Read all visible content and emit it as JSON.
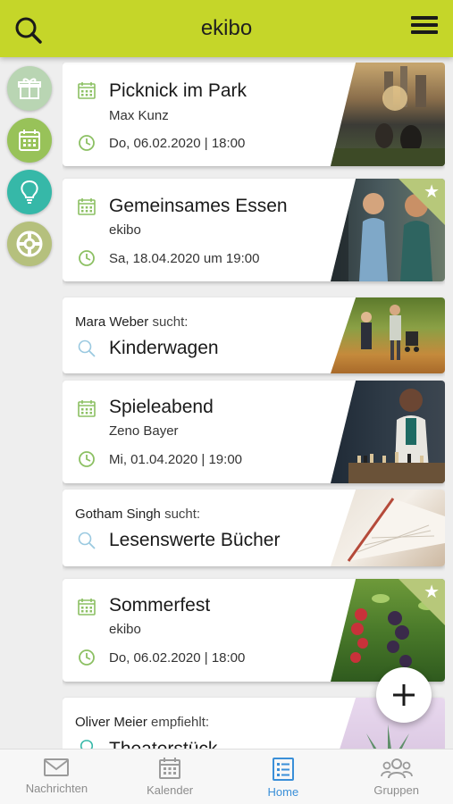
{
  "header": {
    "title": "ekibo"
  },
  "filters": [
    {
      "icon": "gift-icon",
      "color": "#b9d5b3"
    },
    {
      "icon": "calendar-icon",
      "color": "#98c259"
    },
    {
      "icon": "lightbulb-icon",
      "color": "#36b8a8"
    },
    {
      "icon": "lifebuoy-icon",
      "color": "#b5c07d"
    }
  ],
  "feed": {
    "cards": [
      {
        "type": "event",
        "title": "Picknick im Park",
        "organizer": "Max Kunz",
        "date": "Do, 06.02.2020 | 18:00",
        "starred": false
      },
      {
        "type": "event",
        "title": "Gemeinsames Essen",
        "organizer": "ekibo",
        "date": "Sa, 18.04.2020 um 19:00",
        "starred": true
      },
      {
        "type": "search",
        "user": "Mara Weber",
        "verb": "sucht:",
        "title": "Kinderwagen"
      },
      {
        "type": "event",
        "title": "Spieleabend",
        "organizer": "Zeno Bayer",
        "date": "Mi, 01.04.2020 | 19:00",
        "starred": false
      },
      {
        "type": "search",
        "user": "Gotham Singh",
        "verb": "sucht:",
        "title": "Lesenswerte Bücher"
      },
      {
        "type": "event",
        "title": "Sommerfest",
        "organizer": "ekibo",
        "date": "Do, 06.02.2020 | 18:00",
        "starred": true
      },
      {
        "type": "recommend",
        "user": "Oliver Meier",
        "verb": "empfiehlt:",
        "title": "Theaterstück"
      }
    ]
  },
  "nav": {
    "tabs": [
      {
        "label": "Nachrichten",
        "icon": "envelope-icon",
        "active": false
      },
      {
        "label": "Kalender",
        "icon": "calendar-icon",
        "active": false
      },
      {
        "label": "Home",
        "icon": "list-icon",
        "active": true
      },
      {
        "label": "Gruppen",
        "icon": "group-icon",
        "active": false
      }
    ]
  },
  "colors": {
    "accent": "#c5d629",
    "icon_green": "#8cc063",
    "active_tab": "#3a8fd8"
  }
}
